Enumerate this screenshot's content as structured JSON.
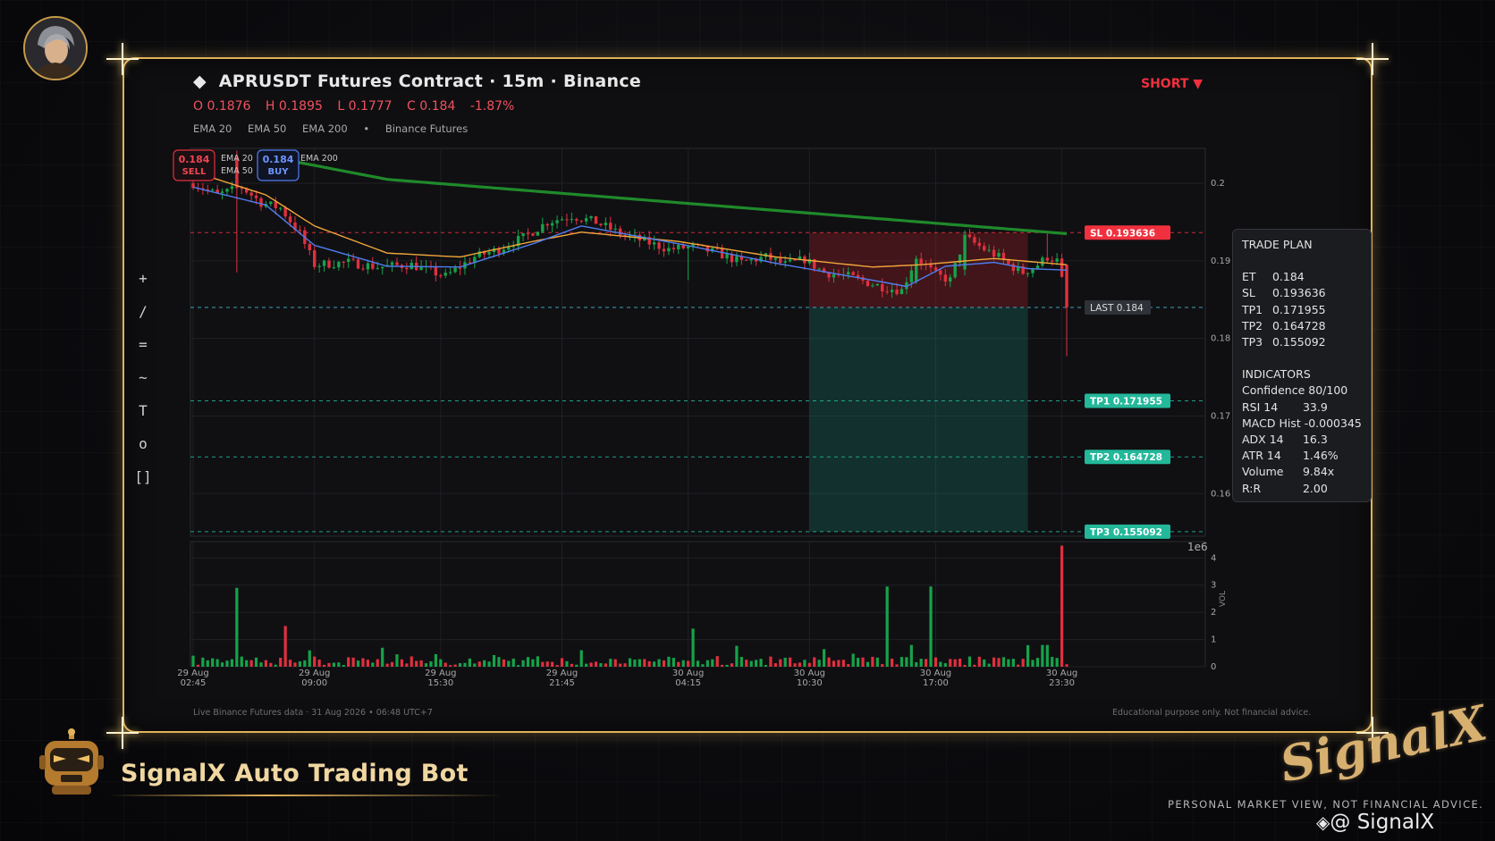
{
  "header": {
    "title": "APRUSDT Futures Contract  ·  15m  ·  Binance",
    "ohlc": [
      "O 0.1876",
      "H 0.1895",
      "L 0.1777",
      "C 0.184",
      "-1.87%"
    ],
    "legend": [
      "EMA 20",
      "EMA 50",
      "EMA 200",
      "•",
      "Binance Futures"
    ],
    "side": "SHORT ▼"
  },
  "toolbar": [
    "+",
    "/",
    "=",
    "~",
    "T",
    "o",
    "[]"
  ],
  "chart_data": {
    "type": "candlestick",
    "symbol": "APRUSDT",
    "interval": "15m",
    "ylim": [
      0.1545,
      0.2045
    ],
    "yticks": [
      0.16,
      0.17,
      0.18,
      0.19,
      0.2
    ],
    "y_multiplier_label": "1e6",
    "x_tick_labels": [
      {
        "i": 0,
        "l1": "29 Aug",
        "l2": "02:45"
      },
      {
        "i": 25,
        "l1": "29 Aug",
        "l2": "09:00"
      },
      {
        "i": 51,
        "l1": "29 Aug",
        "l2": "15:30"
      },
      {
        "i": 76,
        "l1": "29 Aug",
        "l2": "21:45"
      },
      {
        "i": 102,
        "l1": "30 Aug",
        "l2": "04:15"
      },
      {
        "i": 127,
        "l1": "30 Aug",
        "l2": "10:30"
      },
      {
        "i": 153,
        "l1": "30 Aug",
        "l2": "17:00"
      },
      {
        "i": 179,
        "l1": "30 Aug",
        "l2": "23:30"
      }
    ],
    "close_anchors": [
      [
        0,
        0.2
      ],
      [
        5,
        0.1985
      ],
      [
        10,
        0.1995
      ],
      [
        14,
        0.1975
      ],
      [
        18,
        0.1968
      ],
      [
        22,
        0.1935
      ],
      [
        25,
        0.1895
      ],
      [
        32,
        0.1898
      ],
      [
        38,
        0.1892
      ],
      [
        45,
        0.1895
      ],
      [
        52,
        0.188
      ],
      [
        58,
        0.1905
      ],
      [
        63,
        0.1915
      ],
      [
        68,
        0.193
      ],
      [
        73,
        0.195
      ],
      [
        78,
        0.1958
      ],
      [
        83,
        0.195
      ],
      [
        88,
        0.1935
      ],
      [
        93,
        0.1925
      ],
      [
        98,
        0.1915
      ],
      [
        103,
        0.1918
      ],
      [
        108,
        0.191
      ],
      [
        113,
        0.1898
      ],
      [
        118,
        0.1905
      ],
      [
        122,
        0.1895
      ],
      [
        126,
        0.1902
      ],
      [
        130,
        0.1885
      ],
      [
        135,
        0.188
      ],
      [
        140,
        0.187
      ],
      [
        143,
        0.1865
      ],
      [
        146,
        0.1862
      ],
      [
        149,
        0.1905
      ],
      [
        153,
        0.1882
      ],
      [
        156,
        0.1875
      ],
      [
        159,
        0.193
      ],
      [
        163,
        0.1915
      ],
      [
        166,
        0.1905
      ],
      [
        168,
        0.1895
      ],
      [
        171,
        0.1885
      ],
      [
        174,
        0.1895
      ],
      [
        176,
        0.1905
      ],
      [
        178,
        0.19
      ],
      [
        179,
        0.1875
      ],
      [
        180,
        0.184
      ]
    ],
    "ema20_anchors": [
      [
        0,
        0.1995
      ],
      [
        15,
        0.1972
      ],
      [
        25,
        0.192
      ],
      [
        40,
        0.1893
      ],
      [
        55,
        0.1892
      ],
      [
        70,
        0.1922
      ],
      [
        80,
        0.1945
      ],
      [
        100,
        0.1922
      ],
      [
        120,
        0.1897
      ],
      [
        140,
        0.1875
      ],
      [
        147,
        0.1867
      ],
      [
        155,
        0.1893
      ],
      [
        165,
        0.1898
      ],
      [
        172,
        0.189
      ],
      [
        180,
        0.1888
      ]
    ],
    "ema50_anchors": [
      [
        0,
        0.2015
      ],
      [
        15,
        0.1985
      ],
      [
        25,
        0.1945
      ],
      [
        40,
        0.191
      ],
      [
        55,
        0.1905
      ],
      [
        70,
        0.1925
      ],
      [
        80,
        0.1937
      ],
      [
        100,
        0.1925
      ],
      [
        120,
        0.1905
      ],
      [
        140,
        0.1892
      ],
      [
        150,
        0.1895
      ],
      [
        165,
        0.1903
      ],
      [
        180,
        0.1895
      ]
    ],
    "ema200_anchors": [
      [
        15,
        0.2035
      ],
      [
        40,
        0.2005
      ],
      [
        60,
        0.1995
      ],
      [
        80,
        0.1985
      ],
      [
        100,
        0.1975
      ],
      [
        120,
        0.1965
      ],
      [
        140,
        0.1955
      ],
      [
        160,
        0.1945
      ],
      [
        180,
        0.1935
      ]
    ],
    "volume_ylim": [
      0,
      4.6
    ],
    "volume_yticks": [
      0,
      1,
      2,
      3,
      4
    ],
    "volume_axis_label": "VOL",
    "volume_spikes": [
      [
        9,
        2.9,
        "up"
      ],
      [
        19,
        1.5,
        "dn"
      ],
      [
        103,
        1.4,
        "up"
      ],
      [
        143,
        2.95,
        "up"
      ],
      [
        148,
        0.8,
        "up"
      ],
      [
        152,
        2.95,
        "up"
      ],
      [
        175,
        0.8,
        "up"
      ],
      [
        176,
        0.8,
        "up"
      ],
      [
        179,
        4.45,
        "dn"
      ]
    ],
    "trade_zone": {
      "start_i": 127,
      "end_i": 172,
      "entry": 0.184,
      "sl": 0.193636,
      "tp": 0.155092
    },
    "levels": [
      {
        "name": "SL",
        "value": 0.193636,
        "color": "#f0303e",
        "label": "SL  0.193636"
      },
      {
        "name": "LAST",
        "value": 0.184,
        "color": "#4ab8d8",
        "label": "LAST  0.184"
      },
      {
        "name": "TP1",
        "value": 0.171955,
        "color": "#23b89a",
        "label": "TP1  0.171955"
      },
      {
        "name": "TP2",
        "value": 0.164728,
        "color": "#23b89a",
        "label": "TP2  0.164728"
      },
      {
        "name": "TP3",
        "value": 0.155092,
        "color": "#23b89a",
        "label": "TP3  0.155092"
      }
    ],
    "chart_legend": [
      "EMA 20",
      "EMA 50",
      "EMA 200"
    ],
    "sell_box": {
      "price": "0.184",
      "label": "SELL"
    },
    "buy_box": {
      "price": "0.184",
      "label": "BUY"
    },
    "colors": {
      "up": "#16a34a",
      "down": "#e0303e",
      "ema20": "#4f7df0",
      "ema50": "#f2a63a",
      "ema200": "#1f8a2a"
    }
  },
  "trade_plan": {
    "title": "TRADE PLAN",
    "rows": [
      [
        "ET",
        "0.184"
      ],
      [
        "SL",
        "0.193636"
      ],
      [
        "TP1",
        "0.171955"
      ],
      [
        "TP2",
        "0.164728"
      ],
      [
        "TP3",
        "0.155092"
      ]
    ],
    "indicators_title": "INDICATORS",
    "indicators": [
      [
        "Confidence",
        "80/100"
      ],
      [
        "RSI 14",
        "33.9"
      ],
      [
        "MACD Hist",
        "-0.000345"
      ],
      [
        "ADX 14",
        "16.3"
      ],
      [
        "ATR 14",
        "1.46%"
      ],
      [
        "Volume",
        "9.84x"
      ],
      [
        "R:R",
        "2.00"
      ]
    ]
  },
  "footer": {
    "left": "Live Binance Futures data  ·  31 Aug 2026 • 06:48 UTC+7",
    "right": "Educational purpose only. Not financial advice."
  },
  "branding": {
    "bot_name": "SignalX Auto Trading Bot",
    "logo": "SignalX",
    "tagline": "PERSONAL MARKET VIEW, NOT FINANCIAL ADVICE.",
    "handle": "@ SignalX"
  }
}
